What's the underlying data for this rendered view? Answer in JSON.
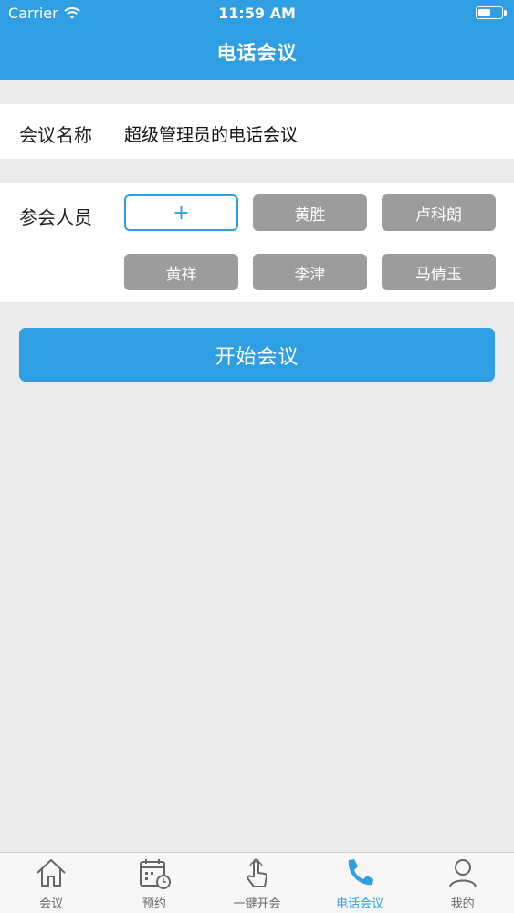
{
  "status_bar": {
    "carrier": "Carrier",
    "time": "11:59 AM"
  },
  "nav": {
    "title": "电话会议"
  },
  "meeting_name": {
    "label": "会议名称",
    "value": "超级管理员的电话会议"
  },
  "participants": {
    "label": "参会人员",
    "add_label": "+",
    "members": [
      "黄胜",
      "卢科朗",
      "黄祥",
      "李津",
      "马倩玉"
    ]
  },
  "start_button": {
    "label": "开始会议"
  },
  "tabbar": {
    "tabs": [
      {
        "label": "会议",
        "icon": "home-icon"
      },
      {
        "label": "预约",
        "icon": "calendar-clock-icon"
      },
      {
        "label": "一键开会",
        "icon": "tap-hand-icon"
      },
      {
        "label": "电话会议",
        "icon": "phone-icon",
        "active": true
      },
      {
        "label": "我的",
        "icon": "person-icon"
      }
    ]
  },
  "colors": {
    "accent": "#2f9ee3",
    "chip": "#9c9c9c",
    "background": "#ebebeb"
  }
}
